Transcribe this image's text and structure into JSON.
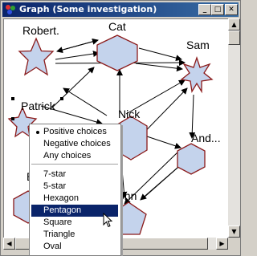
{
  "window": {
    "title": "Graph (Some investigation)"
  },
  "nodes": {
    "robert": "Robert.",
    "cat": "Cat",
    "sam": "Sam",
    "patrick": "Patrick",
    "nick": "Nick",
    "andrew": "And...",
    "partial_b": "B",
    "john": "ohn"
  },
  "menu": {
    "choices": [
      "Positive choices",
      "Negative choices",
      "Any choices"
    ],
    "shapes": [
      "7-star",
      "5-star",
      "Hexagon",
      "Pentagon",
      "Square",
      "Triangle",
      "Oval"
    ],
    "checked": "Positive choices",
    "highlighted": "Pentagon"
  },
  "colors": {
    "node_fill": "#c4d3ec",
    "node_stroke": "#8b1a1a",
    "titlebar": "#0a246a",
    "highlight": "#0a246a"
  },
  "icons": [
    "app-icon",
    "minimize-icon",
    "maximize-icon",
    "close-icon",
    "scroll-up-icon",
    "scroll-down-icon",
    "scroll-left-icon",
    "scroll-right-icon",
    "mouse-cursor-icon"
  ]
}
